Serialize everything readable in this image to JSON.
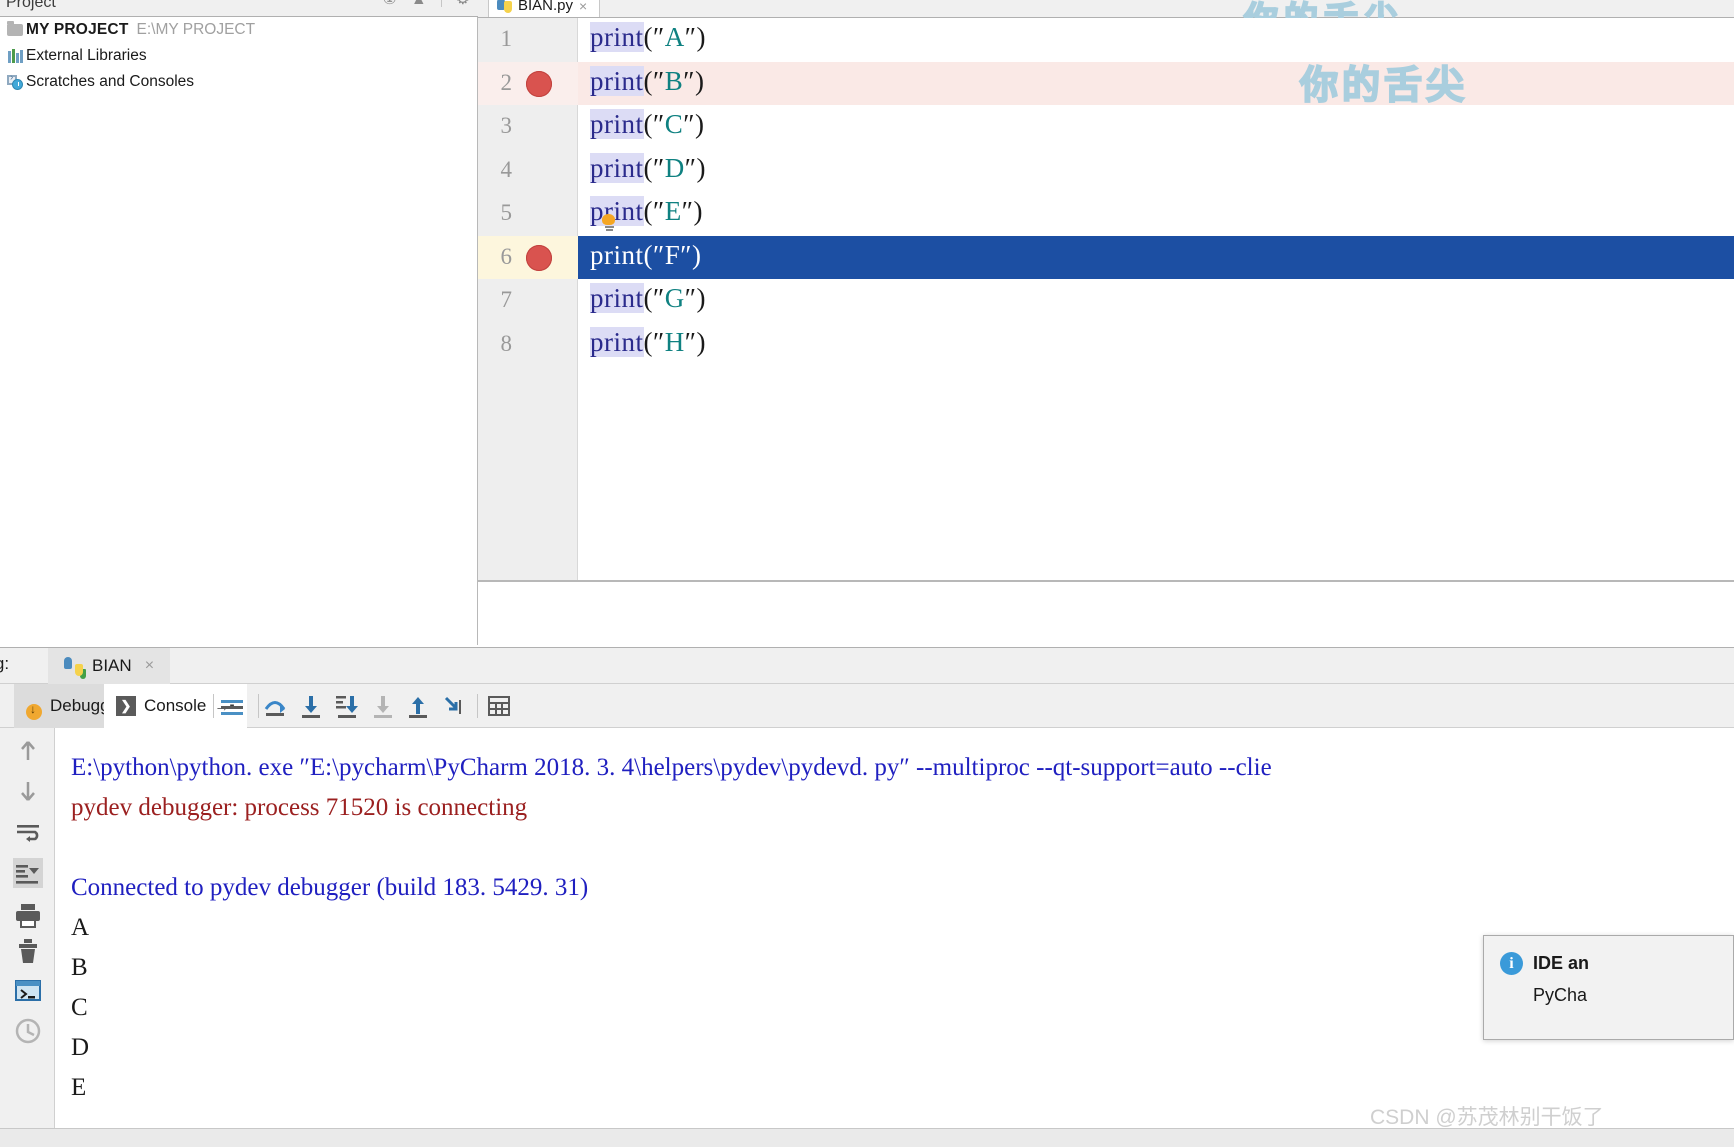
{
  "project_panel": {
    "header_label": "Project",
    "header_icons": [
      "collapse-all-icon",
      "hide-icon",
      "settings-icon"
    ],
    "tree": [
      {
        "icon": "folder-icon",
        "label": "MY PROJECT",
        "path": "E:\\MY PROJECT"
      },
      {
        "icon": "library-icon",
        "label": "External Libraries",
        "path": ""
      },
      {
        "icon": "scratches-icon",
        "label": "Scratches and Consoles",
        "path": ""
      }
    ]
  },
  "editor": {
    "tab": {
      "label": "BIAN.py",
      "close": "×",
      "icon": "python-file-icon"
    },
    "watermark_top": "你的舌尖",
    "watermark_main": "你的舌尖",
    "lines": [
      {
        "num": "1",
        "kw": "print",
        "open": "(″",
        "arg": "A",
        "close": "″)",
        "breakpoint": false,
        "executing": false
      },
      {
        "num": "2",
        "kw": "print",
        "open": "(″",
        "arg": "B",
        "close": "″)",
        "breakpoint": true,
        "executing": false
      },
      {
        "num": "3",
        "kw": "print",
        "open": "(″",
        "arg": "C",
        "close": "″)",
        "breakpoint": false,
        "executing": false
      },
      {
        "num": "4",
        "kw": "print",
        "open": "(″",
        "arg": "D",
        "close": "″)",
        "breakpoint": false,
        "executing": false
      },
      {
        "num": "5",
        "kw": "print",
        "open": "(″",
        "arg": "E",
        "close": "″)",
        "breakpoint": false,
        "executing": false
      },
      {
        "num": "6",
        "kw": "print",
        "open": "(″",
        "arg": "F",
        "close": "″)",
        "breakpoint": true,
        "executing": true
      },
      {
        "num": "7",
        "kw": "print",
        "open": "(″",
        "arg": "G",
        "close": "″)",
        "breakpoint": false,
        "executing": false
      },
      {
        "num": "8",
        "kw": "print",
        "open": "(″",
        "arg": "H",
        "close": "″)",
        "breakpoint": false,
        "executing": false
      }
    ],
    "intention_bulb": "lightbulb-icon"
  },
  "debug": {
    "panel_label": "bug:",
    "run_tab": {
      "label": "BIAN",
      "close": "×",
      "icon": "python-run-icon"
    },
    "tabs": [
      {
        "label": "Debugger",
        "icon": "debugger-icon",
        "selected": true
      },
      {
        "label": "Console",
        "icon": "console-icon",
        "selected": false,
        "pin": "→▪"
      }
    ],
    "toolbar_icons": [
      "soft-wrap-icon",
      "step-over-icon",
      "step-into-icon",
      "step-into-my-code-icon",
      "force-step-into-icon",
      "step-out-icon",
      "run-to-cursor-icon",
      "evaluate-expression-icon"
    ],
    "side_icons": [
      "scroll-up-icon",
      "scroll-down-icon",
      "soft-wrap-lines-icon",
      "scroll-to-end-icon",
      "print-icon",
      "clear-all-icon",
      "terminal-icon",
      "history-icon"
    ],
    "console_output": [
      {
        "text": "E:\\python\\python. exe ″E:\\pycharm\\PyCharm 2018. 3. 4\\helpers\\pydev\\pydevd. py″ --multiproc --qt-support=auto --clie",
        "color": "blue"
      },
      {
        "text": "pydev debugger: process 71520 is connecting",
        "color": "red"
      },
      {
        "text": "",
        "color": "black"
      },
      {
        "text": "Connected to pydev debugger (build 183. 5429. 31)",
        "color": "blue"
      },
      {
        "text": "A",
        "color": "black"
      },
      {
        "text": "B",
        "color": "black"
      },
      {
        "text": "C",
        "color": "black"
      },
      {
        "text": "D",
        "color": "black"
      },
      {
        "text": "E",
        "color": "black"
      }
    ]
  },
  "notification": {
    "icon": "info-icon",
    "title": "IDE an",
    "body": "PyCha"
  },
  "watermark_csdn": "CSDN @苏茂林别干饭了",
  "colors": {
    "breakpoint": "#d9534f",
    "executing_line": "#1c4fa3",
    "keyword": "#2a2a8c",
    "string": "#0f8181",
    "console_blue": "#2020c0",
    "console_red": "#9b2020",
    "accent_blue": "#3a9ad9"
  }
}
